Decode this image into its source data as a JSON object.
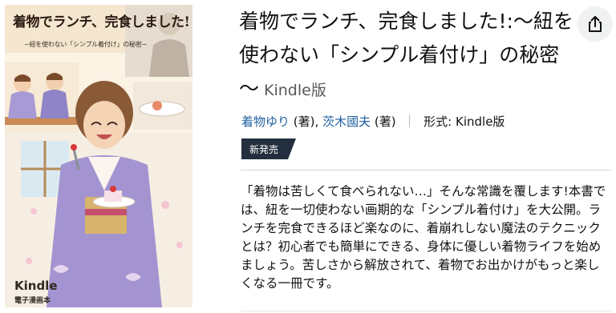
{
  "cover": {
    "title": "着物でランチ、完食しました!",
    "subtitle": "~紐を使わない「シンプル着付け」の秘密~",
    "logo": "Kindle",
    "logo_sub": "電子漫画本"
  },
  "product": {
    "title": "着物でランチ、完食しました!:～紐を使わない「シンプル着付け」の秘密～",
    "format_label": "Kindle版"
  },
  "byline": {
    "author1": "着物ゆり",
    "author1_role": "(著)",
    "separator": ",",
    "author2": "茨木國夫",
    "author2_role": "(著)",
    "format_prefix": "形式:",
    "format_value": "Kindle版"
  },
  "badge": {
    "label": "新発売"
  },
  "description": "「着物は苦しくて食べられない…」そんな常識を覆します!本書では、紐を一切使わない画期的な「シンプル着付け」を大公開。ランチを完食できるほど楽なのに、着崩れしない魔法のテクニックとは？初心者でも簡単にできる、身体に優しい着物ライフを始めましょう。苦しさから解放されて、着物でお出かけがもっと楽しくなる一冊です。",
  "icons": {
    "share": "share-icon"
  },
  "colors": {
    "link": "#2162a1",
    "badge": "#232f3e",
    "text": "#0f1111",
    "muted": "#565959"
  }
}
